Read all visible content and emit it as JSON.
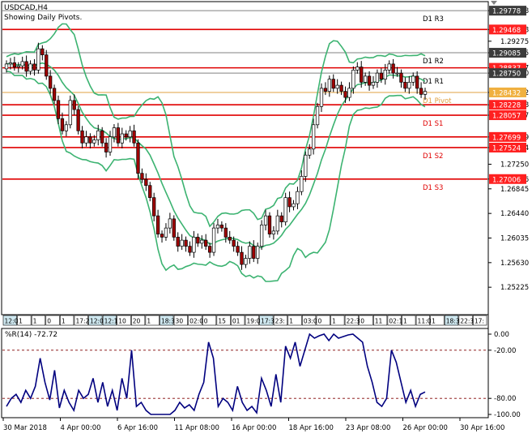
{
  "window": {
    "symbol_title": "USDCAD,H4",
    "indicator_caption": "Showing Daily Pivots."
  },
  "colors": {
    "background": "#ffffff",
    "frame": "#000000",
    "pivot_red": "#e00000",
    "pivot_gray": "#808080",
    "pivot_orange": "#e0a040",
    "bands": "#3cb371",
    "candle_up": "#ffffff",
    "candle_down": "#a00000",
    "wick": "#000000",
    "wpr_line": "#00007f",
    "wpr_level": "#800000",
    "price_tag_dark": "#3c3c3c",
    "price_tag_red": "#ff2020",
    "price_tag_orange": "#f0b040"
  },
  "chart_data": [
    {
      "type": "candlestick",
      "title": "USDCAD,H4",
      "subtitle": "Showing Daily Pivots.",
      "ylim": [
        1.248,
        1.299
      ],
      "y_ticks": [
        "1.29778",
        "1.29468",
        "1.29275",
        "1.29085",
        "1.28837",
        "1.28750",
        "1.28432",
        "1.28228",
        "1.28057",
        "1.27699",
        "1.27524",
        "1.27250",
        "1.27006",
        "1.26845",
        "1.26440",
        "1.26035",
        "1.25630",
        "1.25225"
      ],
      "pivot_levels": [
        {
          "label": "D1 R3",
          "value": 1.29778,
          "color": "#808080"
        },
        {
          "label": "",
          "value": 1.29468,
          "color": "#e00000"
        },
        {
          "label": "D1 R2",
          "value": 1.29085,
          "color": "#808080"
        },
        {
          "label": "",
          "value": 1.28837,
          "color": "#e00000"
        },
        {
          "label": "D1 R1",
          "value": 1.2875,
          "color": "#808080"
        },
        {
          "label": "D1 Pivot",
          "value": 1.28432,
          "color": "#e0a040"
        },
        {
          "label": "",
          "value": 1.28228,
          "color": "#e00000"
        },
        {
          "label": "D1 S1",
          "value": 1.28057,
          "color": "#e00000"
        },
        {
          "label": "",
          "value": 1.27699,
          "color": "#e00000"
        },
        {
          "label": "D1 S2",
          "value": 1.27524,
          "color": "#e00000"
        },
        {
          "label": "D1 S3",
          "value": 1.27006,
          "color": "#e00000"
        }
      ],
      "price_tags": [
        {
          "text": "1.29778",
          "value": 1.29778,
          "style": "dark"
        },
        {
          "text": "1.29468",
          "value": 1.29468,
          "style": "red"
        },
        {
          "text": "1.29085",
          "value": 1.29085,
          "style": "dark"
        },
        {
          "text": "1.28837",
          "value": 1.28837,
          "style": "red"
        },
        {
          "text": "1.28750",
          "value": 1.2875,
          "style": "dark"
        },
        {
          "text": "1.28432",
          "value": 1.28432,
          "style": "orange"
        },
        {
          "text": "1.28228",
          "value": 1.28228,
          "style": "red"
        },
        {
          "text": "1.28057",
          "value": 1.28057,
          "style": "red"
        },
        {
          "text": "1.27699",
          "value": 1.27699,
          "style": "red"
        },
        {
          "text": "1.27524",
          "value": 1.27524,
          "style": "red"
        },
        {
          "text": "1.27006",
          "value": 1.27006,
          "style": "red"
        }
      ],
      "close_series": [
        1.289,
        1.2892,
        1.2885,
        1.2887,
        1.2894,
        1.2878,
        1.289,
        1.288,
        1.2915,
        1.2905,
        1.287,
        1.285,
        1.283,
        1.28,
        1.278,
        1.279,
        1.283,
        1.2815,
        1.278,
        1.276,
        1.277,
        1.276,
        1.2765,
        1.278,
        1.276,
        1.2745,
        1.277,
        1.2785,
        1.276,
        1.2775,
        1.277,
        1.278,
        1.276,
        1.271,
        1.27,
        1.269,
        1.267,
        1.264,
        1.261,
        1.2605,
        1.262,
        1.2635,
        1.2605,
        1.259,
        1.26,
        1.259,
        1.258,
        1.2605,
        1.2595,
        1.26,
        1.259,
        1.258,
        1.262,
        1.2625,
        1.262,
        1.2605,
        1.26,
        1.259,
        1.258,
        1.256,
        1.257,
        1.259,
        1.257,
        1.259,
        1.2625,
        1.264,
        1.261,
        1.2615,
        1.264,
        1.263,
        1.267,
        1.2655,
        1.266,
        1.268,
        1.2705,
        1.274,
        1.275,
        1.279,
        1.282,
        1.285,
        1.2845,
        1.2865,
        1.285,
        1.2855,
        1.2845,
        1.2835,
        1.285,
        1.288,
        1.2885,
        1.286,
        1.287,
        1.2855,
        1.286,
        1.2875,
        1.2865,
        1.288,
        1.289,
        1.2875,
        1.2875,
        1.286,
        1.285,
        1.286,
        1.287,
        1.285,
        1.284,
        1.2845
      ],
      "bands_note": "Bollinger-style bands shown in green",
      "sub_indicator": {
        "type": "line",
        "label": "%R(14) -72.72",
        "ylim": [
          -100,
          0
        ],
        "y_ticks": [
          "0.00",
          "-20.00",
          "-80.00",
          "-100.00"
        ],
        "levels": [
          -20,
          -80
        ],
        "values": [
          -90,
          -80,
          -75,
          -85,
          -70,
          -80,
          -65,
          -30,
          -60,
          -82,
          -45,
          -92,
          -70,
          -85,
          -95,
          -70,
          -80,
          -75,
          -55,
          -85,
          -60,
          -90,
          -70,
          -95,
          -55,
          -80,
          -20,
          -90,
          -85,
          -95,
          -100,
          -100,
          -100,
          -100,
          -100,
          -95,
          -85,
          -92,
          -88,
          -95,
          -75,
          -60,
          -10,
          -30,
          -90,
          -80,
          -85,
          -95,
          -65,
          -85,
          -95,
          -90,
          -98,
          -55,
          -70,
          -90,
          -50,
          -85,
          -15,
          -30,
          -10,
          -40,
          -20,
          0,
          -5,
          -2,
          0,
          -8,
          0,
          -5,
          -3,
          -1,
          0,
          -5,
          -10,
          -40,
          -60,
          -85,
          -90,
          -80,
          -20,
          -35,
          -60,
          -85,
          -70,
          -90,
          -75,
          -72
        ],
        "xlabels": [
          "30 Mar 2018",
          "4 Apr 00:00",
          "6 Apr 16:00",
          "11 Apr 08:00",
          "16 Apr 00:00",
          "18 Apr 16:00",
          "23 Apr 08:00",
          "26 Apr 00:00",
          "30 Apr 16:00"
        ]
      }
    }
  ],
  "timeline_strip": {
    "cells": [
      "12:0",
      "1",
      "1",
      "0",
      "1",
      "17:2",
      "12:0",
      "12:1",
      "10",
      "20",
      "1",
      "18:30",
      "30",
      "02:00",
      "0",
      "15",
      "01",
      "19:00",
      "17:30",
      "23:",
      "1",
      "03:00",
      "0",
      "1",
      "22:30",
      "0",
      "11",
      "02:15",
      "1",
      "11:00",
      "1",
      "18:30",
      "22:30",
      "17:"
    ]
  }
}
